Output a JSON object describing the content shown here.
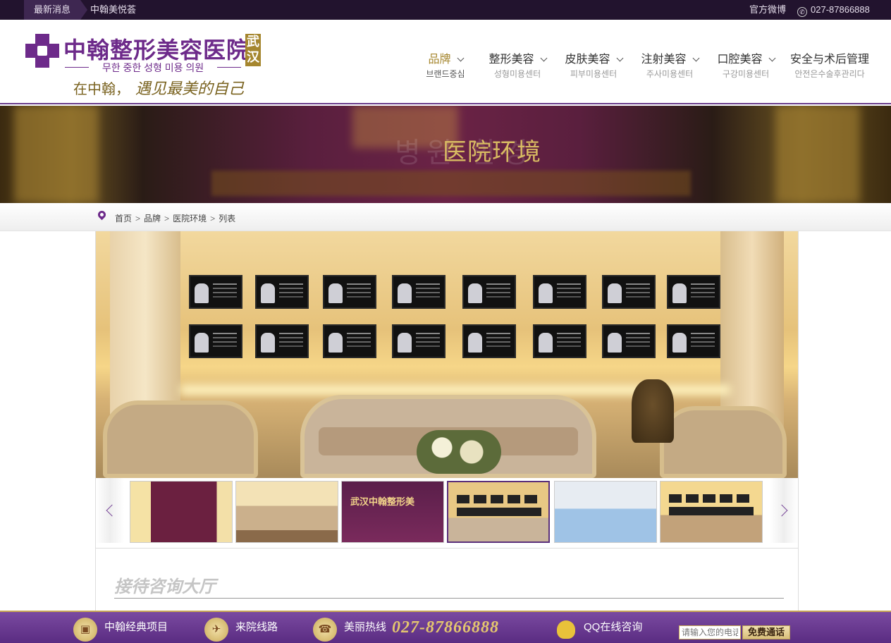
{
  "topbar": {
    "news_label": "最新消息",
    "news_text": "中翰美悦荟",
    "weibo": "官方微博",
    "phone_icon": "✆",
    "phone": "027-87866888"
  },
  "logo": {
    "title": "中翰整形美容医院",
    "city": "武汉",
    "subtitle": "무한 중한 성형 미용 의원",
    "slogan": "在中翰，",
    "slogan_script": "遇见最美的自己"
  },
  "nav": [
    {
      "label": "品牌",
      "sub": "브랜드중심",
      "active": true,
      "dropdown": true
    },
    {
      "label": "整形美容",
      "sub": "성형미용센터",
      "active": false,
      "dropdown": true
    },
    {
      "label": "皮肤美容",
      "sub": "피부미용센터",
      "active": false,
      "dropdown": true
    },
    {
      "label": "注射美容",
      "sub": "주사미용센터",
      "active": false,
      "dropdown": true
    },
    {
      "label": "口腔美容",
      "sub": "구강미용센터",
      "active": false,
      "dropdown": true
    },
    {
      "label": "安全与术后管理",
      "sub": "안전은수술후관리다",
      "active": false,
      "dropdown": false
    }
  ],
  "banner": {
    "title": "医院环境",
    "ghost_text": "병원 환경"
  },
  "breadcrumb": [
    "首页",
    "品牌",
    "医院环境",
    "列表"
  ],
  "gallery": {
    "thumb3_text": "武汉中翰整形美",
    "section_title": "接待咨询大厅"
  },
  "bottombar": {
    "item1": "中翰经典项目",
    "item2": "来院线路",
    "item3": "美丽热线",
    "hotline": "027-87866888",
    "item4": "QQ在线咨询",
    "input_placeholder": "请输入您的电话",
    "call_button": "免费通话"
  }
}
